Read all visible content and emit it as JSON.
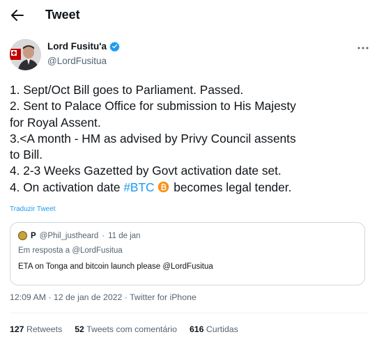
{
  "header": {
    "title": "Tweet"
  },
  "author": {
    "display_name": "Lord Fusitu'a",
    "handle": "@LordFusitua",
    "verified_icon": "verified-badge-icon"
  },
  "tweet": {
    "lines": [
      "1. Sept/Oct Bill goes to Parliament. Passed.",
      "2. Sent to Palace Office for submission to His Majesty",
      "for Royal Assent.",
      "3.<A month - HM as advised by Privy Council assents",
      "to Bill.",
      "4. 2-3 Weeks Gazetted by Govt activation date set."
    ],
    "last_line_start": "4. On activation date ",
    "hashtag": "#BTC",
    "last_line_end": " becomes legal tender.",
    "translate_label": "Traduzir Tweet"
  },
  "quote": {
    "initial": "P",
    "handle": "@Phil_justheard",
    "separator": "·",
    "date": "11 de jan",
    "reply_to": "Em resposta a @LordFusitua",
    "text": "ETA on Tonga and bitcoin launch please @LordFusitua"
  },
  "meta": {
    "time": "12:09 AM",
    "date": "12 de jan de 2022",
    "source": "Twitter for iPhone"
  },
  "stats": {
    "retweets_count": "127",
    "retweets_label": "Retweets",
    "quotes_count": "52",
    "quotes_label": "Tweets com comentário",
    "likes_count": "616",
    "likes_label": "Curtidas"
  },
  "colors": {
    "accent": "#1d9bf0",
    "text": "#0f1419",
    "secondary": "#536471",
    "border": "#cfd9de",
    "bitcoin": "#f7931a"
  }
}
